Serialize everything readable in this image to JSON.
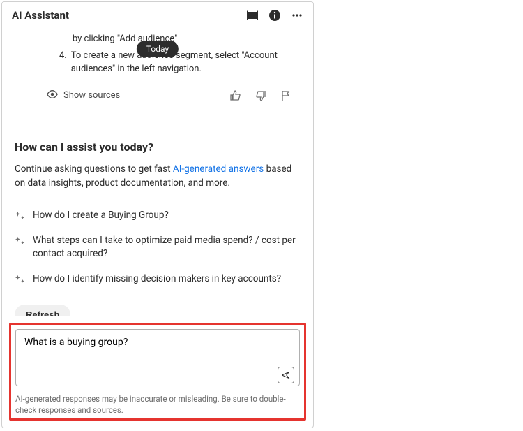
{
  "header": {
    "title": "AI Assistant"
  },
  "today_label": "Today",
  "partial_steps": {
    "item3_tail": "by clicking \"Add audience\"",
    "item4_marker": "4.",
    "item4_text": "To create a new audience segment, select \"Account audiences\" in the left navigation."
  },
  "show_sources": "Show sources",
  "assist": {
    "heading": "How can I assist you today?",
    "intro_pre": "Continue asking questions to get fast ",
    "intro_link": "AI-generated answers",
    "intro_post": " based on data insights, product documentation, and more."
  },
  "suggestions": [
    {
      "text": "How do I create a Buying Group?"
    },
    {
      "text": "What steps can I take to optimize paid media spend? / cost per contact acquired?"
    },
    {
      "text": "How do I identify missing decision makers in key accounts?"
    }
  ],
  "refresh_label": "Refresh",
  "input": {
    "value": "What is a buying group?"
  },
  "disclaimer": "AI-generated responses may be inaccurate or misleading. Be sure to double-check responses and sources."
}
